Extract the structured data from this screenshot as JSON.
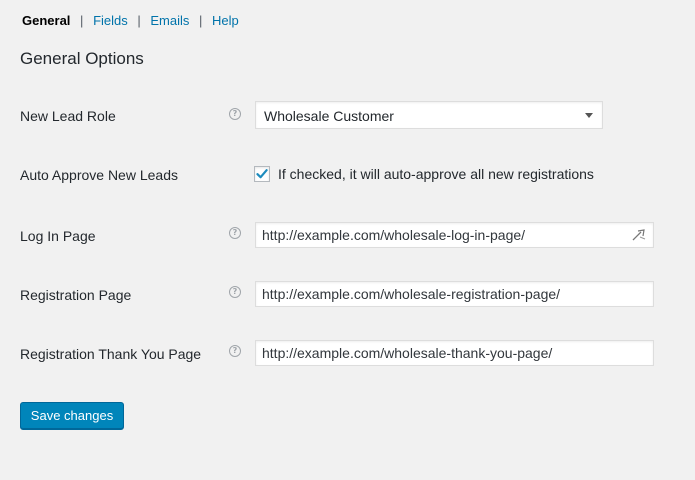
{
  "subnav": {
    "items": [
      {
        "label": "General",
        "current": true
      },
      {
        "label": "Fields",
        "current": false
      },
      {
        "label": "Emails",
        "current": false
      },
      {
        "label": "Help",
        "current": false
      }
    ],
    "separator": "|"
  },
  "section_title": "General Options",
  "help_icon_glyph": "?",
  "fields": {
    "new_lead_role": {
      "label": "New Lead Role",
      "value": "Wholesale Customer"
    },
    "auto_approve": {
      "label": "Auto Approve New Leads",
      "checked": true,
      "description": "If checked, it will auto-approve all new registrations"
    },
    "log_in_page": {
      "label": "Log In Page",
      "value": "http://example.com/wholesale-log-in-page/"
    },
    "registration_page": {
      "label": "Registration Page",
      "value": "http://example.com/wholesale-registration-page/"
    },
    "thank_you_page": {
      "label": "Registration Thank You Page",
      "value": "http://example.com/wholesale-thank-you-page/"
    }
  },
  "save_button_label": "Save changes",
  "colors": {
    "accent": "#0085ba",
    "link": "#0073aa",
    "background": "#f1f1f1",
    "checkmark": "#1e8cbe"
  },
  "icons": {
    "help": "question-circle-icon",
    "dropdown": "chevron-down-icon",
    "checkbox": "checkmark-icon",
    "url": "link-icon"
  }
}
